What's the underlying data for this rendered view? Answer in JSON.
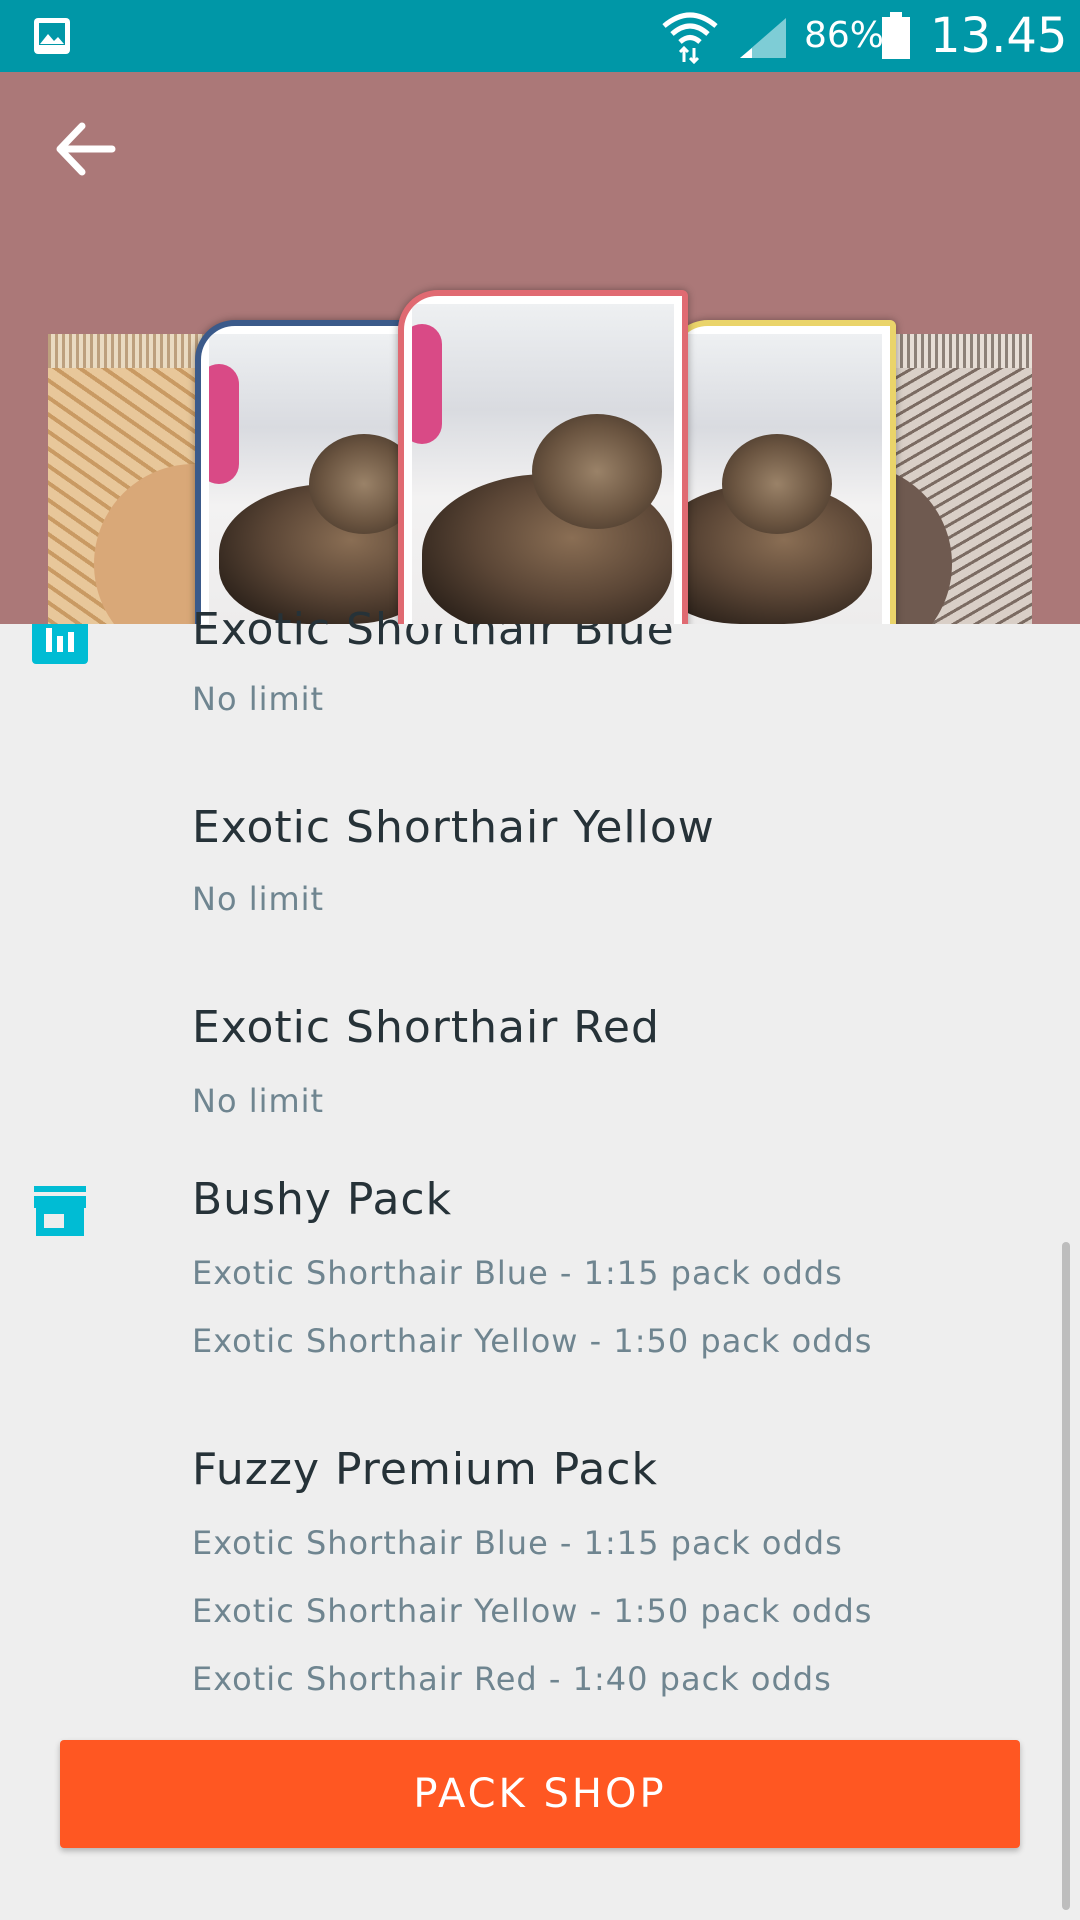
{
  "status_bar": {
    "battery_percent": "86%",
    "time": "13.45",
    "icons": [
      "gallery-icon",
      "wifi-icon",
      "signal-icon",
      "battery-icon"
    ]
  },
  "header": {
    "background": "#ab7878",
    "back_icon": "arrow-left-icon"
  },
  "items": [
    {
      "title": "Exotic Shorthair Blue",
      "subtitle": "No limit"
    },
    {
      "title": "Exotic Shorthair Yellow",
      "subtitle": "No limit"
    },
    {
      "title": "Exotic Shorthair Red",
      "subtitle": "No limit"
    }
  ],
  "packs": [
    {
      "title": "Bushy Pack",
      "odds": [
        "Exotic Shorthair Blue - 1:15 pack odds",
        "Exotic Shorthair Yellow - 1:50 pack odds"
      ]
    },
    {
      "title": "Fuzzy Premium Pack",
      "odds": [
        "Exotic Shorthair Blue - 1:15 pack odds",
        "Exotic Shorthair Yellow - 1:50 pack odds",
        "Exotic Shorthair Red - 1:40 pack odds"
      ]
    }
  ],
  "section_icons": [
    "bar-chart-icon",
    "store-icon"
  ],
  "pack_shop": {
    "label": "PACK SHOP",
    "color": "#ff5722"
  },
  "colors": {
    "status_bar": "#0097a7",
    "accent": "#00bcd4"
  }
}
